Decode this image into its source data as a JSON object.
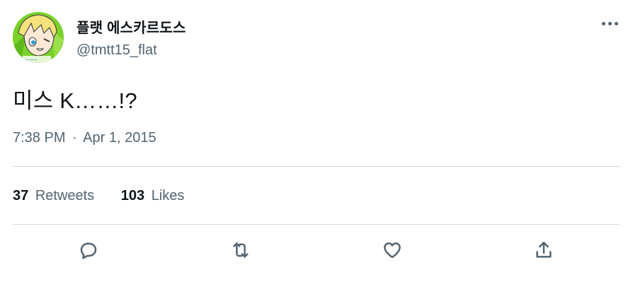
{
  "tweet": {
    "author": {
      "display_name": "플랫 에스카르도스",
      "handle": "@tmtt15_flat",
      "avatar": "anime-avatar"
    },
    "more_icon": "more-horizontal-icon",
    "text": "미스 K……!?",
    "time": "7:38 PM",
    "separator": "·",
    "date": "Apr 1, 2015",
    "stats": {
      "retweets_count": "37",
      "retweets_label": "Retweets",
      "likes_count": "103",
      "likes_label": "Likes"
    },
    "actions": [
      "reply-icon",
      "retweet-icon",
      "like-icon",
      "share-icon"
    ],
    "colors": {
      "text": "#0f1419",
      "secondary": "#536471",
      "divider": "#cfd9de",
      "avatar_bg": "#7bd12a"
    }
  }
}
